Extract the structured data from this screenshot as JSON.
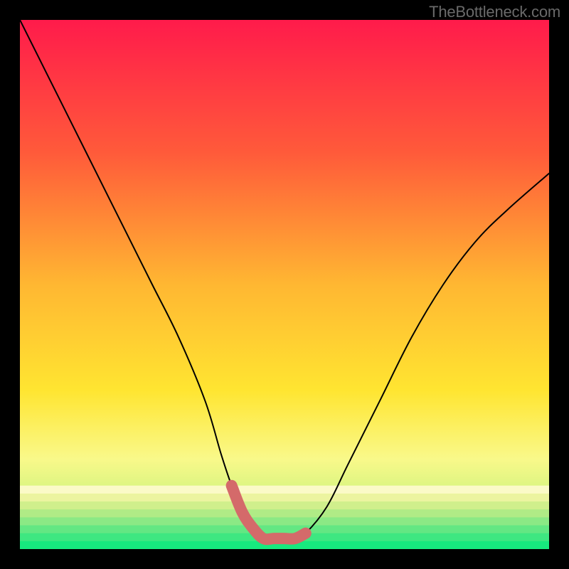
{
  "watermark": "TheBottleneck.com",
  "chart_data": {
    "type": "line",
    "title": "",
    "xlabel": "",
    "ylabel": "",
    "xlim": [
      0,
      100
    ],
    "ylim": [
      0,
      100
    ],
    "series": [
      {
        "name": "curve",
        "color": "#000000",
        "x": [
          0,
          5,
          10,
          15,
          20,
          25,
          30,
          35,
          38,
          40,
          42,
          44,
          46,
          48,
          50,
          52,
          54,
          58,
          62,
          68,
          74,
          80,
          86,
          92,
          100
        ],
        "y": [
          100,
          90,
          80,
          70,
          60,
          50,
          40,
          28,
          18,
          12,
          7,
          4,
          2,
          2,
          2,
          2,
          3,
          8,
          16,
          28,
          40,
          50,
          58,
          64,
          71
        ]
      },
      {
        "name": "highlight",
        "color": "#d46a6a",
        "x": [
          40,
          42,
          44,
          46,
          48,
          50,
          52,
          54
        ],
        "y": [
          12,
          7,
          4,
          2,
          2,
          2,
          2,
          3
        ]
      }
    ],
    "background_gradient": {
      "stops": [
        {
          "offset": 0.0,
          "color": "#ff1b4b"
        },
        {
          "offset": 0.25,
          "color": "#ff5a3a"
        },
        {
          "offset": 0.5,
          "color": "#ffb732"
        },
        {
          "offset": 0.7,
          "color": "#ffe531"
        },
        {
          "offset": 0.83,
          "color": "#f9f98a"
        },
        {
          "offset": 0.9,
          "color": "#d4f47f"
        },
        {
          "offset": 0.95,
          "color": "#7ce98a"
        },
        {
          "offset": 1.0,
          "color": "#17e97e"
        }
      ]
    },
    "bottom_bands": [
      {
        "y0": 0.88,
        "y1": 0.895,
        "color": "#fbfac8"
      },
      {
        "y0": 0.895,
        "y1": 0.91,
        "color": "#ecf4a0"
      },
      {
        "y0": 0.91,
        "y1": 0.925,
        "color": "#d0ef8c"
      },
      {
        "y0": 0.925,
        "y1": 0.94,
        "color": "#b0eb86"
      },
      {
        "y0": 0.94,
        "y1": 0.955,
        "color": "#8be985"
      },
      {
        "y0": 0.955,
        "y1": 0.97,
        "color": "#63e783"
      },
      {
        "y0": 0.97,
        "y1": 0.985,
        "color": "#3ee781"
      },
      {
        "y0": 0.985,
        "y1": 1.0,
        "color": "#17e97e"
      }
    ]
  }
}
